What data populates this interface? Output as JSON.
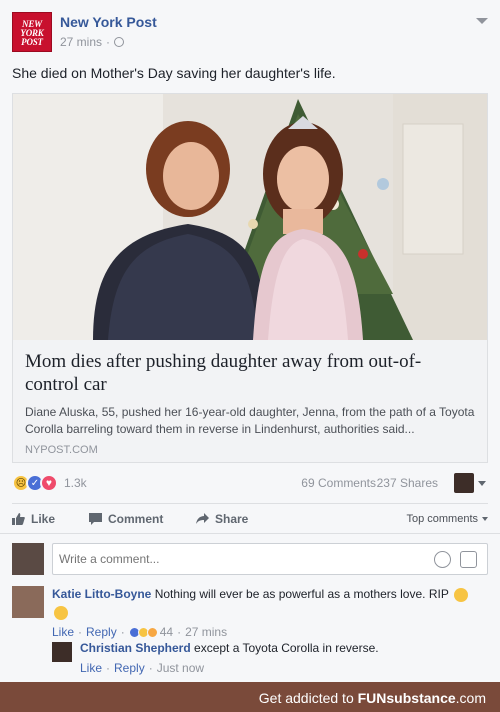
{
  "post": {
    "page_name": "New York Post",
    "logo_lines": [
      "NEW",
      "YORK",
      "POST"
    ],
    "time": "27 mins",
    "text": "She died on Mother's Day saving her daughter's life."
  },
  "link": {
    "title": "Mom dies after pushing daughter away from out-of-control car",
    "description": "Diane Aluska, 55, pushed her 16-year-old daughter, Jenna, from the path of a Toyota Corolla barreling toward them in reverse in Lindenhurst, authorities said...",
    "domain": "NYPOST.COM"
  },
  "stats": {
    "reactions": "1.3k",
    "comments": "69 Comments",
    "shares": "237 Shares"
  },
  "actions": {
    "like": "Like",
    "comment": "Comment",
    "share": "Share",
    "sort": "Top comments"
  },
  "composer": {
    "placeholder": "Write a comment..."
  },
  "comments": [
    {
      "author": "Katie Litto-Boyne",
      "text": "Nothing will ever be as powerful as a mothers love. RIP",
      "like": "Like",
      "reply": "Reply",
      "reactions": "44",
      "time": "27 mins"
    }
  ],
  "reply": {
    "author": "Christian Shepherd",
    "text": "except a Toyota Corolla in reverse.",
    "like": "Like",
    "reply": "Reply",
    "time": "Just now"
  },
  "footer": {
    "prefix": "Get addicted to",
    "brand": "FUNsubstance",
    "suffix": ".com"
  },
  "colors": {
    "link_blue": "#365899",
    "muted": "#90949c",
    "footer_bg": "#7a4a3a"
  }
}
